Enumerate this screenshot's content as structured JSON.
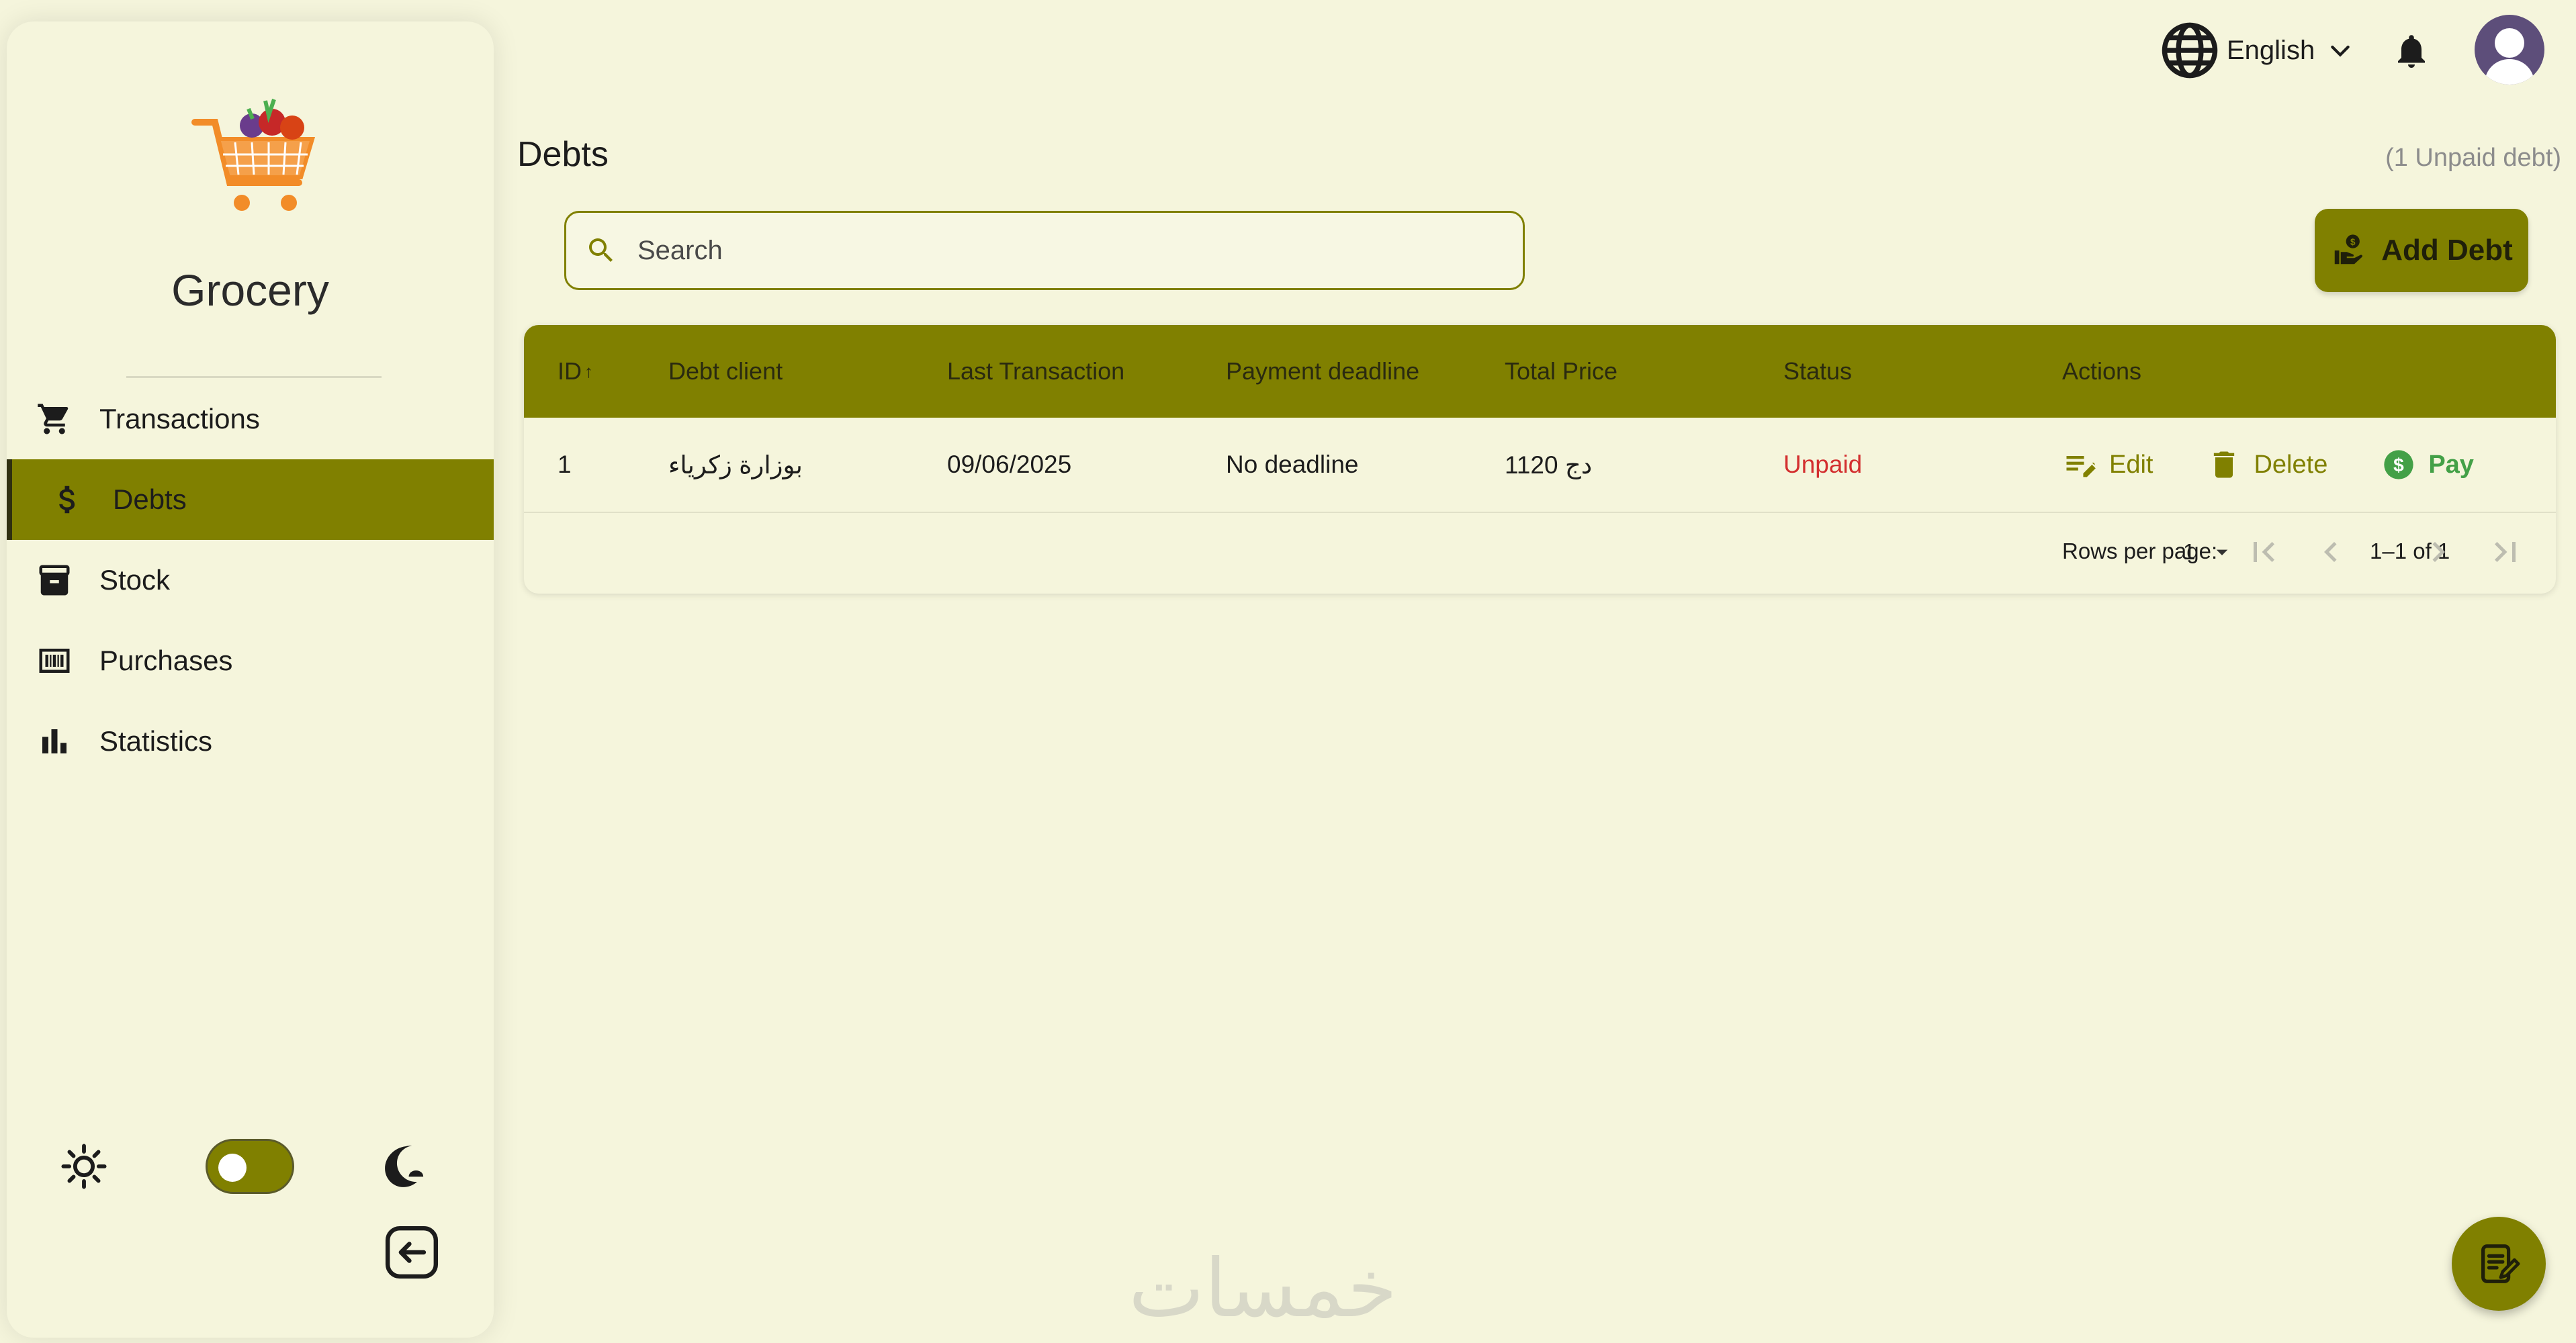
{
  "app": {
    "name": "Grocery"
  },
  "sidebar": {
    "items": [
      {
        "label": "Transactions",
        "icon": "cart-icon",
        "active": false
      },
      {
        "label": "Debts",
        "icon": "dollar-icon",
        "active": true
      },
      {
        "label": "Stock",
        "icon": "archive-icon",
        "active": false
      },
      {
        "label": "Purchases",
        "icon": "barcode-icon",
        "active": false
      },
      {
        "label": "Statistics",
        "icon": "bar-chart-icon",
        "active": false
      }
    ],
    "theme_toggle": {
      "mode": "light"
    }
  },
  "topbar": {
    "language": "English"
  },
  "page": {
    "title": "Debts",
    "unpaid_count": "(1 Unpaid debt)"
  },
  "search": {
    "placeholder": "Search"
  },
  "add_button": {
    "label": "Add Debt"
  },
  "table": {
    "headers": [
      "ID",
      "Debt client",
      "Last Transaction",
      "Payment deadline",
      "Total Price",
      "Status",
      "Actions"
    ],
    "rows": [
      {
        "id": "1",
        "client": "بوزارة زكرياء",
        "last_transaction": "09/06/2025",
        "deadline": "No deadline",
        "total": "1120 دج",
        "status": "Unpaid"
      }
    ],
    "actions": {
      "edit": "Edit",
      "delete": "Delete",
      "pay": "Pay"
    },
    "pagination": {
      "rows_label": "Rows per page:",
      "rows_value": "1",
      "range": "1–1 of 1"
    }
  },
  "watermark": "خمسات",
  "colors": {
    "accent": "#808000",
    "background": "#f5f5dc",
    "unpaid": "#d32f2f",
    "pay": "#43a047"
  }
}
